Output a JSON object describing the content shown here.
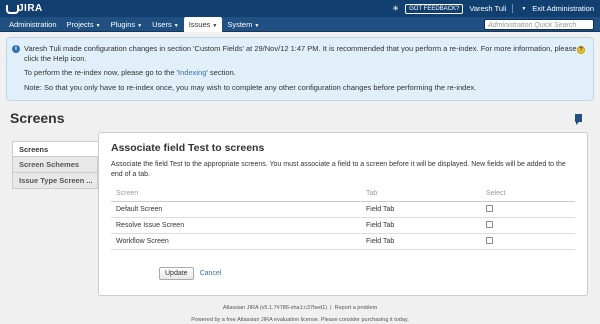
{
  "header": {
    "logo": "JIRA",
    "feedback": "GOT FEEDBACK?",
    "user": "Varesh Tuli",
    "exit_admin": "Exit Administration"
  },
  "nav": {
    "items": [
      {
        "label": "Administration"
      },
      {
        "label": "Projects"
      },
      {
        "label": "Plugins"
      },
      {
        "label": "Users"
      },
      {
        "label": "Issues"
      },
      {
        "label": "System"
      }
    ],
    "search_placeholder": "Administration Quick Search"
  },
  "message": {
    "line1": "Varesh Tuli made configuration changes in section 'Custom Fields' at 29/Nov/12 1:47 PM. It is recommended that you perform a re-index. For more information, please click the Help icon.",
    "line2_prefix": "To perform the re-index now, please go to the '",
    "line2_link": "Indexing",
    "line2_suffix": "' section.",
    "line3": "Note: So that you only have to re-index once, you may wish to complete any other configuration changes before performing the re-index."
  },
  "page": {
    "title": "Screens"
  },
  "sidebar": {
    "items": [
      {
        "label": "Screens"
      },
      {
        "label": "Screen Schemes"
      },
      {
        "label": "Issue Type Screen ..."
      }
    ]
  },
  "panel": {
    "title": "Associate field Test to screens",
    "description": "Associate the field Test to the appropriate screens. You must associate a field to a screen before it will be displayed. New fields will be added to the end of a tab.",
    "columns": {
      "screen": "Screen",
      "tab": "Tab",
      "select": "Select"
    },
    "rows": [
      {
        "screen": "Default Screen",
        "tab": "Field Tab"
      },
      {
        "screen": "Resolve Issue Screen",
        "tab": "Field Tab"
      },
      {
        "screen": "Workflow Screen",
        "tab": "Field Tab"
      }
    ],
    "update_label": "Update",
    "cancel_label": "Cancel"
  },
  "footer": {
    "line1_version": "Atlassian JIRA (v5.1.7#786-sha1:c37bed1)",
    "line1_report": "Report a problem",
    "line2": "Powered by a free Atlassian JIRA evaluation license. Please consider purchasing it today."
  },
  "colors": {
    "header_bg": "#114070",
    "nav_bg": "#205081",
    "info_bg": "#e0eff8",
    "link": "#3b73af"
  }
}
